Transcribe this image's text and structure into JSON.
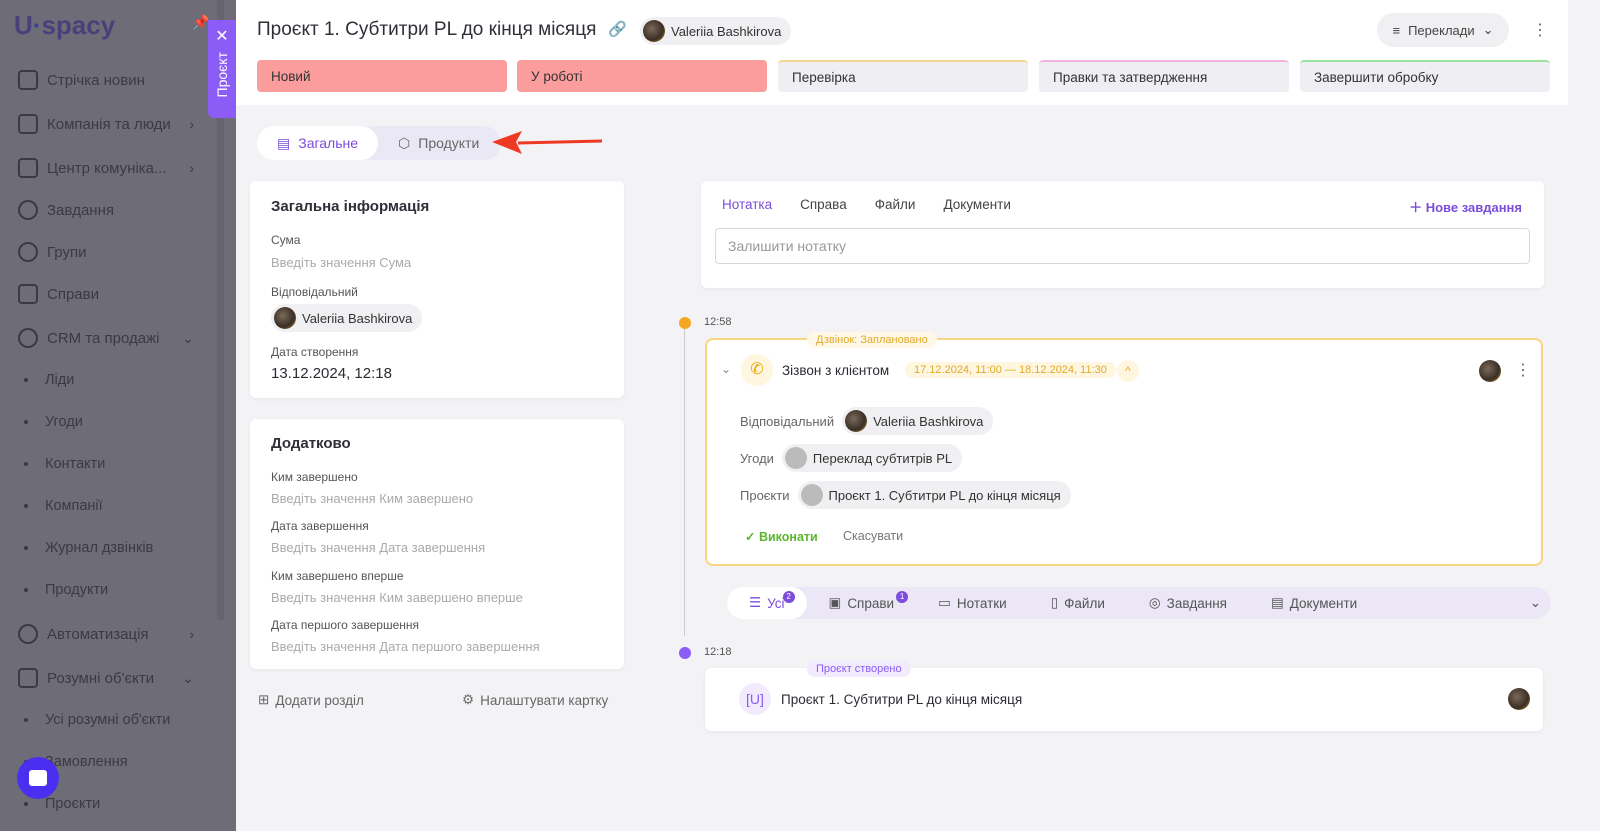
{
  "sidebar": {
    "logo": "Uspacy",
    "items": [
      {
        "label": "Стрічка новин"
      },
      {
        "label": "Компанія та люди"
      },
      {
        "label": "Центр комуніка..."
      },
      {
        "label": "Завдання"
      },
      {
        "label": "Групи"
      },
      {
        "label": "Справи"
      },
      {
        "label": "CRM та продажі"
      }
    ],
    "crm_sub": [
      "Ліди",
      "Угоди",
      "Контакти",
      "Компанії",
      "Журнал дзвінків",
      "Продукти"
    ],
    "automation": "Автоматизація",
    "smart": "Розумні об'єкти",
    "smart_sub": [
      "Усі розумні об'єкти",
      "Замовлення",
      "Проєкти"
    ]
  },
  "panel_tab": "Проєкт",
  "header": {
    "title": "Проєкт 1. Субтитри PL до кінця місяця",
    "owner": "Valeriia Bashkirova",
    "filter": "Переклади",
    "stages": [
      {
        "label": "Новий",
        "color": "#fb9d9d"
      },
      {
        "label": "У роботі",
        "color": "#fb9d9d"
      },
      {
        "label": "Перевірка",
        "color": "#f6d58e"
      },
      {
        "label": "Правки та затвердження",
        "color": "#f0b4df"
      },
      {
        "label": "Завершити обробку",
        "color": "#9be39b"
      }
    ]
  },
  "view_tabs": [
    "Загальне",
    "Продукти"
  ],
  "general": {
    "title": "Загальна інформація",
    "sum_label": "Сума",
    "sum_ph": "Введіть значення Сума",
    "resp_label": "Відповідальний",
    "resp": "Valeriia Bashkirova",
    "created_label": "Дата створення",
    "created": "13.12.2024, 12:18"
  },
  "extra": {
    "title": "Додатково",
    "fields": [
      {
        "label": "Ким завершено",
        "ph": "Введіть значення Ким завершено"
      },
      {
        "label": "Дата завершення",
        "ph": "Введіть значення Дата завершення"
      },
      {
        "label": "Ким завершено вперше",
        "ph": "Введіть значення Ким завершено вперше"
      },
      {
        "label": "Дата першого завершення",
        "ph": "Введіть значення Дата першого завершення"
      }
    ]
  },
  "footer": {
    "add": "Додати розділ",
    "setup": "Налаштувати картку"
  },
  "note": {
    "tabs": [
      "Нотатка",
      "Справа",
      "Файли",
      "Документи"
    ],
    "new_task": "Нове завдання",
    "placeholder": "Залишити нотатку"
  },
  "timeline": {
    "t1": "12:58",
    "call_tag": "Дзвінок: Заплановано",
    "call_title": "Зізвон з клієнтом",
    "call_range": "17.12.2024, 11:00 — 18.12.2024, 11:30",
    "resp_label": "Відповідальний",
    "resp": "Valeriia Bashkirova",
    "deals_label": "Угоди",
    "deal": "Переклад субтитрів PL",
    "proj_label": "Проєкти",
    "proj": "Проєкт 1. Субтитри PL до кінця місяця",
    "done": "Виконати",
    "cancel": "Скасувати",
    "t2": "12:18",
    "created_tag": "Проєкт створено",
    "created_title": "Проєкт 1. Субтитри PL до кінця місяця"
  },
  "filters": [
    {
      "label": "Усі",
      "badge": "2"
    },
    {
      "label": "Справи",
      "badge": "1"
    },
    {
      "label": "Нотатки"
    },
    {
      "label": "Файли"
    },
    {
      "label": "Завдання"
    },
    {
      "label": "Документи"
    }
  ]
}
